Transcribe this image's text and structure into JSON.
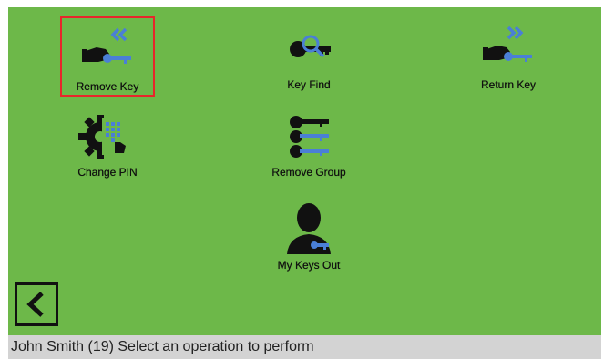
{
  "operations": [
    {
      "id": "remove-key",
      "label": "Remove Key",
      "icon": "hand-key-remove-icon",
      "selected": true
    },
    {
      "id": "key-find",
      "label": "Key Find",
      "icon": "key-search-icon",
      "selected": false
    },
    {
      "id": "return-key",
      "label": "Return Key",
      "icon": "hand-key-return-icon",
      "selected": false
    },
    {
      "id": "change-pin",
      "label": "Change PIN",
      "icon": "gear-keypad-icon",
      "selected": false
    },
    {
      "id": "remove-group",
      "label": "Remove Group",
      "icon": "key-group-icon",
      "selected": false
    },
    {
      "id": "my-keys-out",
      "label": "My Keys Out",
      "icon": "user-key-icon",
      "selected": false
    }
  ],
  "back_button": {
    "icon": "chevron-left-icon"
  },
  "status": {
    "text": "John Smith (19) Select an operation to perform"
  },
  "colors": {
    "background": "#6db849",
    "accent": "#4a7fd6",
    "selection": "#e8262b",
    "icon": "#111111",
    "status_bar": "#d3d3d3"
  }
}
